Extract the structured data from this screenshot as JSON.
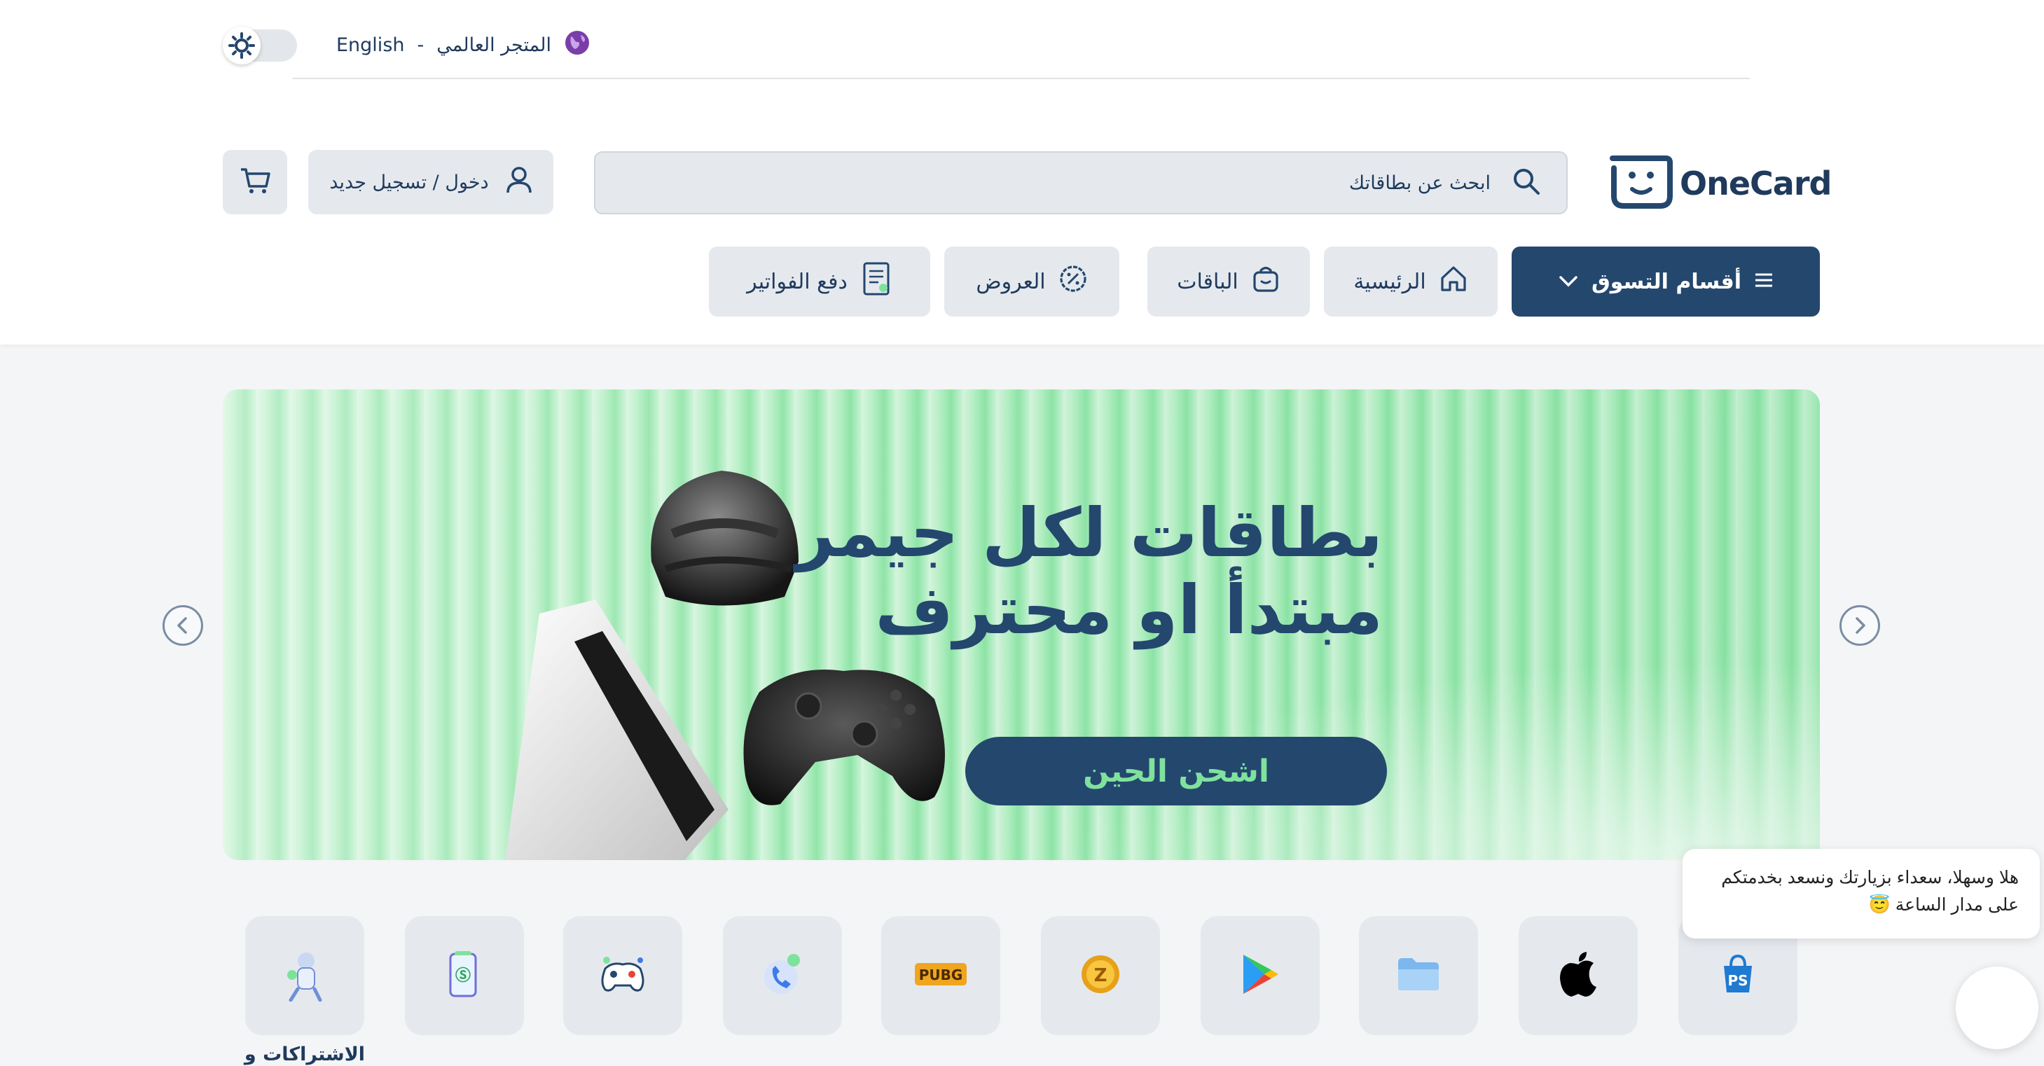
{
  "topbar": {
    "language": "English",
    "separator": "-",
    "store": "المتجر العالمي"
  },
  "logo": {
    "text": "OneCard"
  },
  "search": {
    "placeholder": "ابحث عن بطاقاتك"
  },
  "account": {
    "login_label": "دخول / تسجيل جديد"
  },
  "nav": {
    "categories": "أقسام التسوق",
    "home": "الرئيسية",
    "bundles": "الباقات",
    "offers": "العروض",
    "bills": "دفع الفواتير"
  },
  "banner": {
    "line1": "بطاقات لكل جيمر",
    "line2": "مبتدأ او محترف",
    "cta": "اشحن الحين"
  },
  "categories": [
    {
      "icon": "playstation-icon"
    },
    {
      "icon": "apple-icon"
    },
    {
      "icon": "folder-icon"
    },
    {
      "icon": "google-play-icon"
    },
    {
      "icon": "coin-icon"
    },
    {
      "icon": "pubg-icon"
    },
    {
      "icon": "phone-icon"
    },
    {
      "icon": "gamepad-icon"
    },
    {
      "icon": "mobile-recharge-icon"
    },
    {
      "icon": "subscriptions-icon",
      "label": "الاشتراكات و"
    }
  ],
  "chat": {
    "message": "هلا وسهلا، سعداء بزيارتك ونسعد بخدمتكم على مدار الساعة 😇"
  },
  "colors": {
    "primary": "#24476e",
    "accent": "#7fe29c",
    "surface": "#e5e9ee"
  }
}
